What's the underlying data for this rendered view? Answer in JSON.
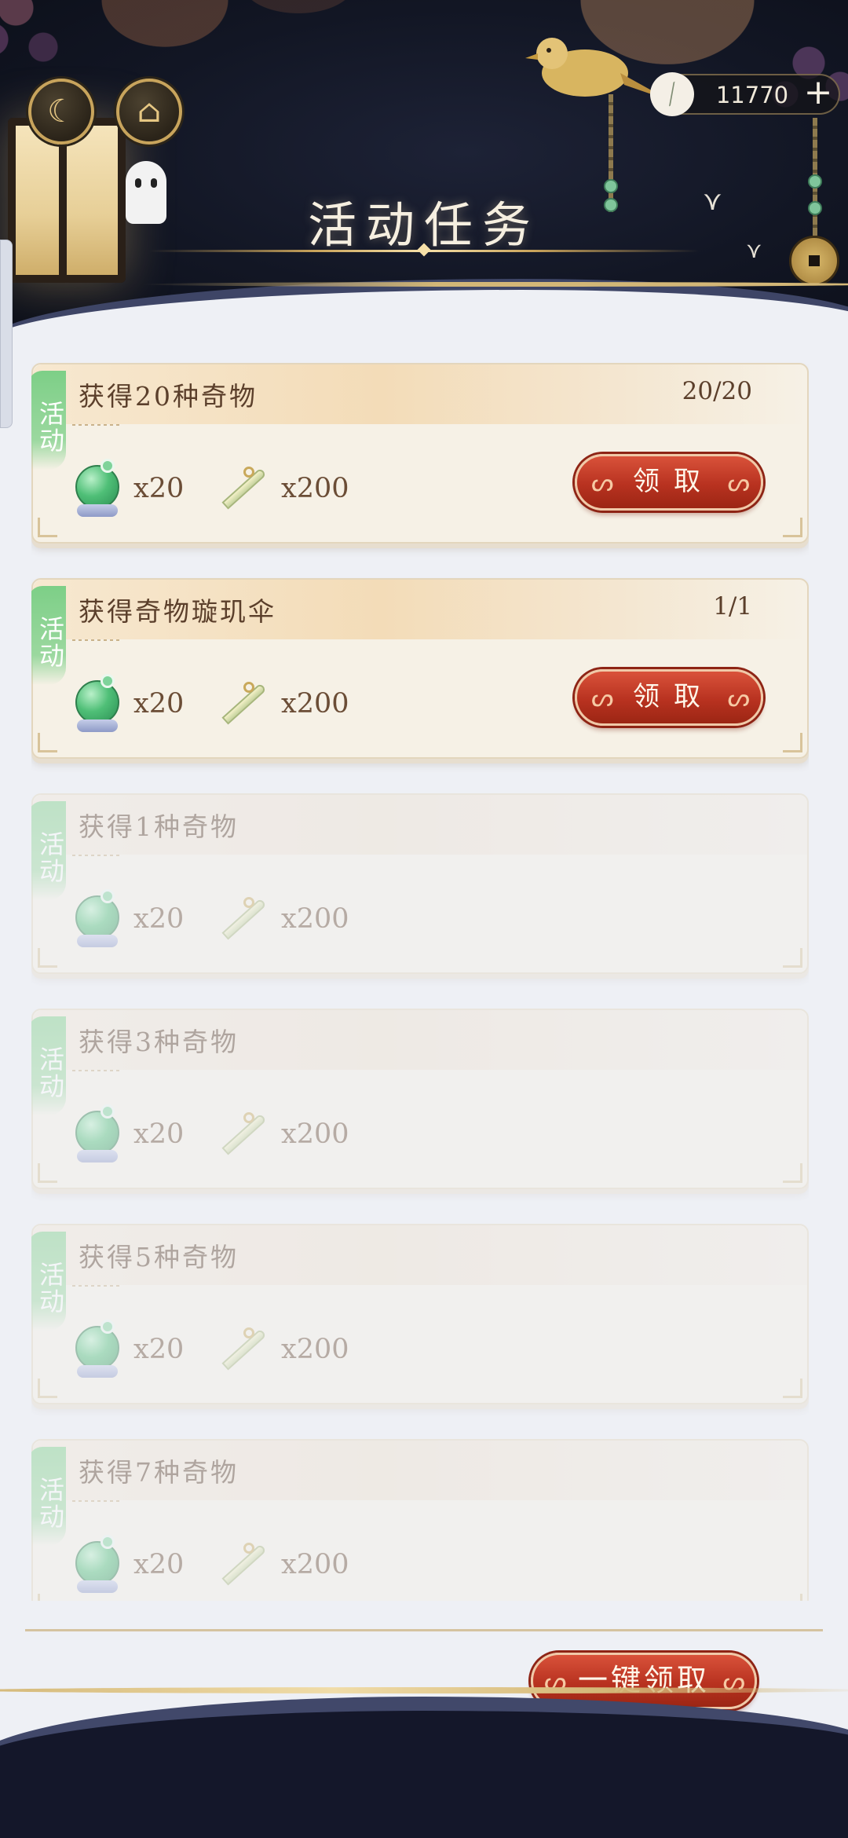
{
  "header": {
    "title": "活动任务",
    "currency": {
      "icon": "blade-icon",
      "value": "11770",
      "add_label": "+"
    },
    "left_buttons": [
      {
        "icon": "moon-icon",
        "glyph": "☾"
      },
      {
        "icon": "pavilion-icon",
        "glyph": "⌂"
      }
    ]
  },
  "tasks": [
    {
      "badge": "活动",
      "name": "获得20种奇物",
      "progress": "20/20",
      "rewards": [
        {
          "icon": "jade-icon",
          "qty": "x20"
        },
        {
          "icon": "blade-icon",
          "qty": "x200"
        }
      ],
      "claim_label": "领取",
      "state": "claimable"
    },
    {
      "badge": "活动",
      "name": "获得奇物璇玑伞",
      "progress": "1/1",
      "rewards": [
        {
          "icon": "jade-icon",
          "qty": "x20"
        },
        {
          "icon": "blade-icon",
          "qty": "x200"
        }
      ],
      "claim_label": "领取",
      "state": "claimable"
    },
    {
      "badge": "活动",
      "name": "获得1种奇物",
      "progress": "",
      "rewards": [
        {
          "icon": "jade-icon",
          "qty": "x20"
        },
        {
          "icon": "blade-icon",
          "qty": "x200"
        }
      ],
      "state": "locked"
    },
    {
      "badge": "活动",
      "name": "获得3种奇物",
      "progress": "",
      "rewards": [
        {
          "icon": "jade-icon",
          "qty": "x20"
        },
        {
          "icon": "blade-icon",
          "qty": "x200"
        }
      ],
      "state": "locked"
    },
    {
      "badge": "活动",
      "name": "获得5种奇物",
      "progress": "",
      "rewards": [
        {
          "icon": "jade-icon",
          "qty": "x20"
        },
        {
          "icon": "blade-icon",
          "qty": "x200"
        }
      ],
      "state": "locked"
    },
    {
      "badge": "活动",
      "name": "获得7种奇物",
      "progress": "",
      "rewards": [
        {
          "icon": "jade-icon",
          "qty": "x20"
        },
        {
          "icon": "blade-icon",
          "qty": "x200"
        }
      ],
      "state": "locked"
    }
  ],
  "footer": {
    "claim_all_label": "一键领取"
  },
  "colors": {
    "accent_red": "#b83220",
    "badge_green": "#7dcf87",
    "card_bg": "#f6f1e6",
    "header_bg": "#121624",
    "text_brown": "#5b3f2b"
  }
}
